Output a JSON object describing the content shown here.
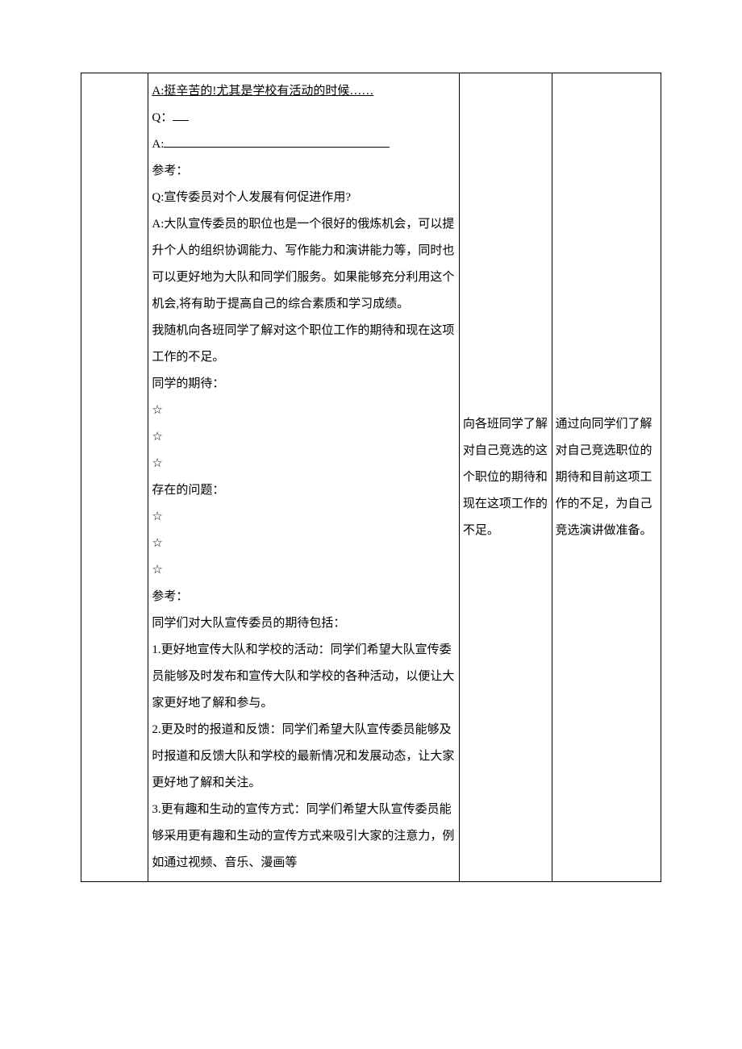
{
  "col2": {
    "a1": "A:挺辛苦的!尤其是学校有活动的时候……",
    "q_prefix": "Q：",
    "a_prefix": "A:",
    "ref_label": "参考：",
    "q2": "Q:宣传委员对个人发展有何促进作用?",
    "a2": "A:大队宣传委员的职位也是一个很好的俄炼机会，可以提升个人的组织协调能力、写作能力和演讲能力等，同时也可以更好地为大队和同学们服务。如果能够充分利用这个机会,将有助于提高自己的综合素质和学习成绩。",
    "survey_intro": "我随机向各班同学了解对这个职位工作的期待和现在这项工作的不足。",
    "expect_label": "同学的期待：",
    "star": "☆",
    "issues_label": "存在的问题：",
    "ref2_label": "参考：",
    "expect_intro": "同学们对大队宣传委员的期待包括：",
    "p1": "1.更好地宣传大队和学校的活动：同学们希望大队宣传委员能够及时发布和宣传大队和学校的各种活动，以便让大家更好地了解和参与。",
    "p2": "2.更及时的报道和反馈：同学们希望大队宣传委员能够及时报道和反馈大队和学校的最新情况和发展动态，让大家更好地了解和关注。",
    "p3": "3.更有趣和生动的宣传方式：同学们希望大队宣传委员能够采用更有趣和生动的宣传方式来吸引大家的注意力，例如通过视频、音乐、漫画等"
  },
  "col3": {
    "text": "向各班同学了解对自己竞选的这个职位的期待和现在这项工作的不足。"
  },
  "col4": {
    "text": "通过向同学们了解对自己竞选职位的期待和目前这项工作的不足，为自己竞选演讲做准备。"
  }
}
